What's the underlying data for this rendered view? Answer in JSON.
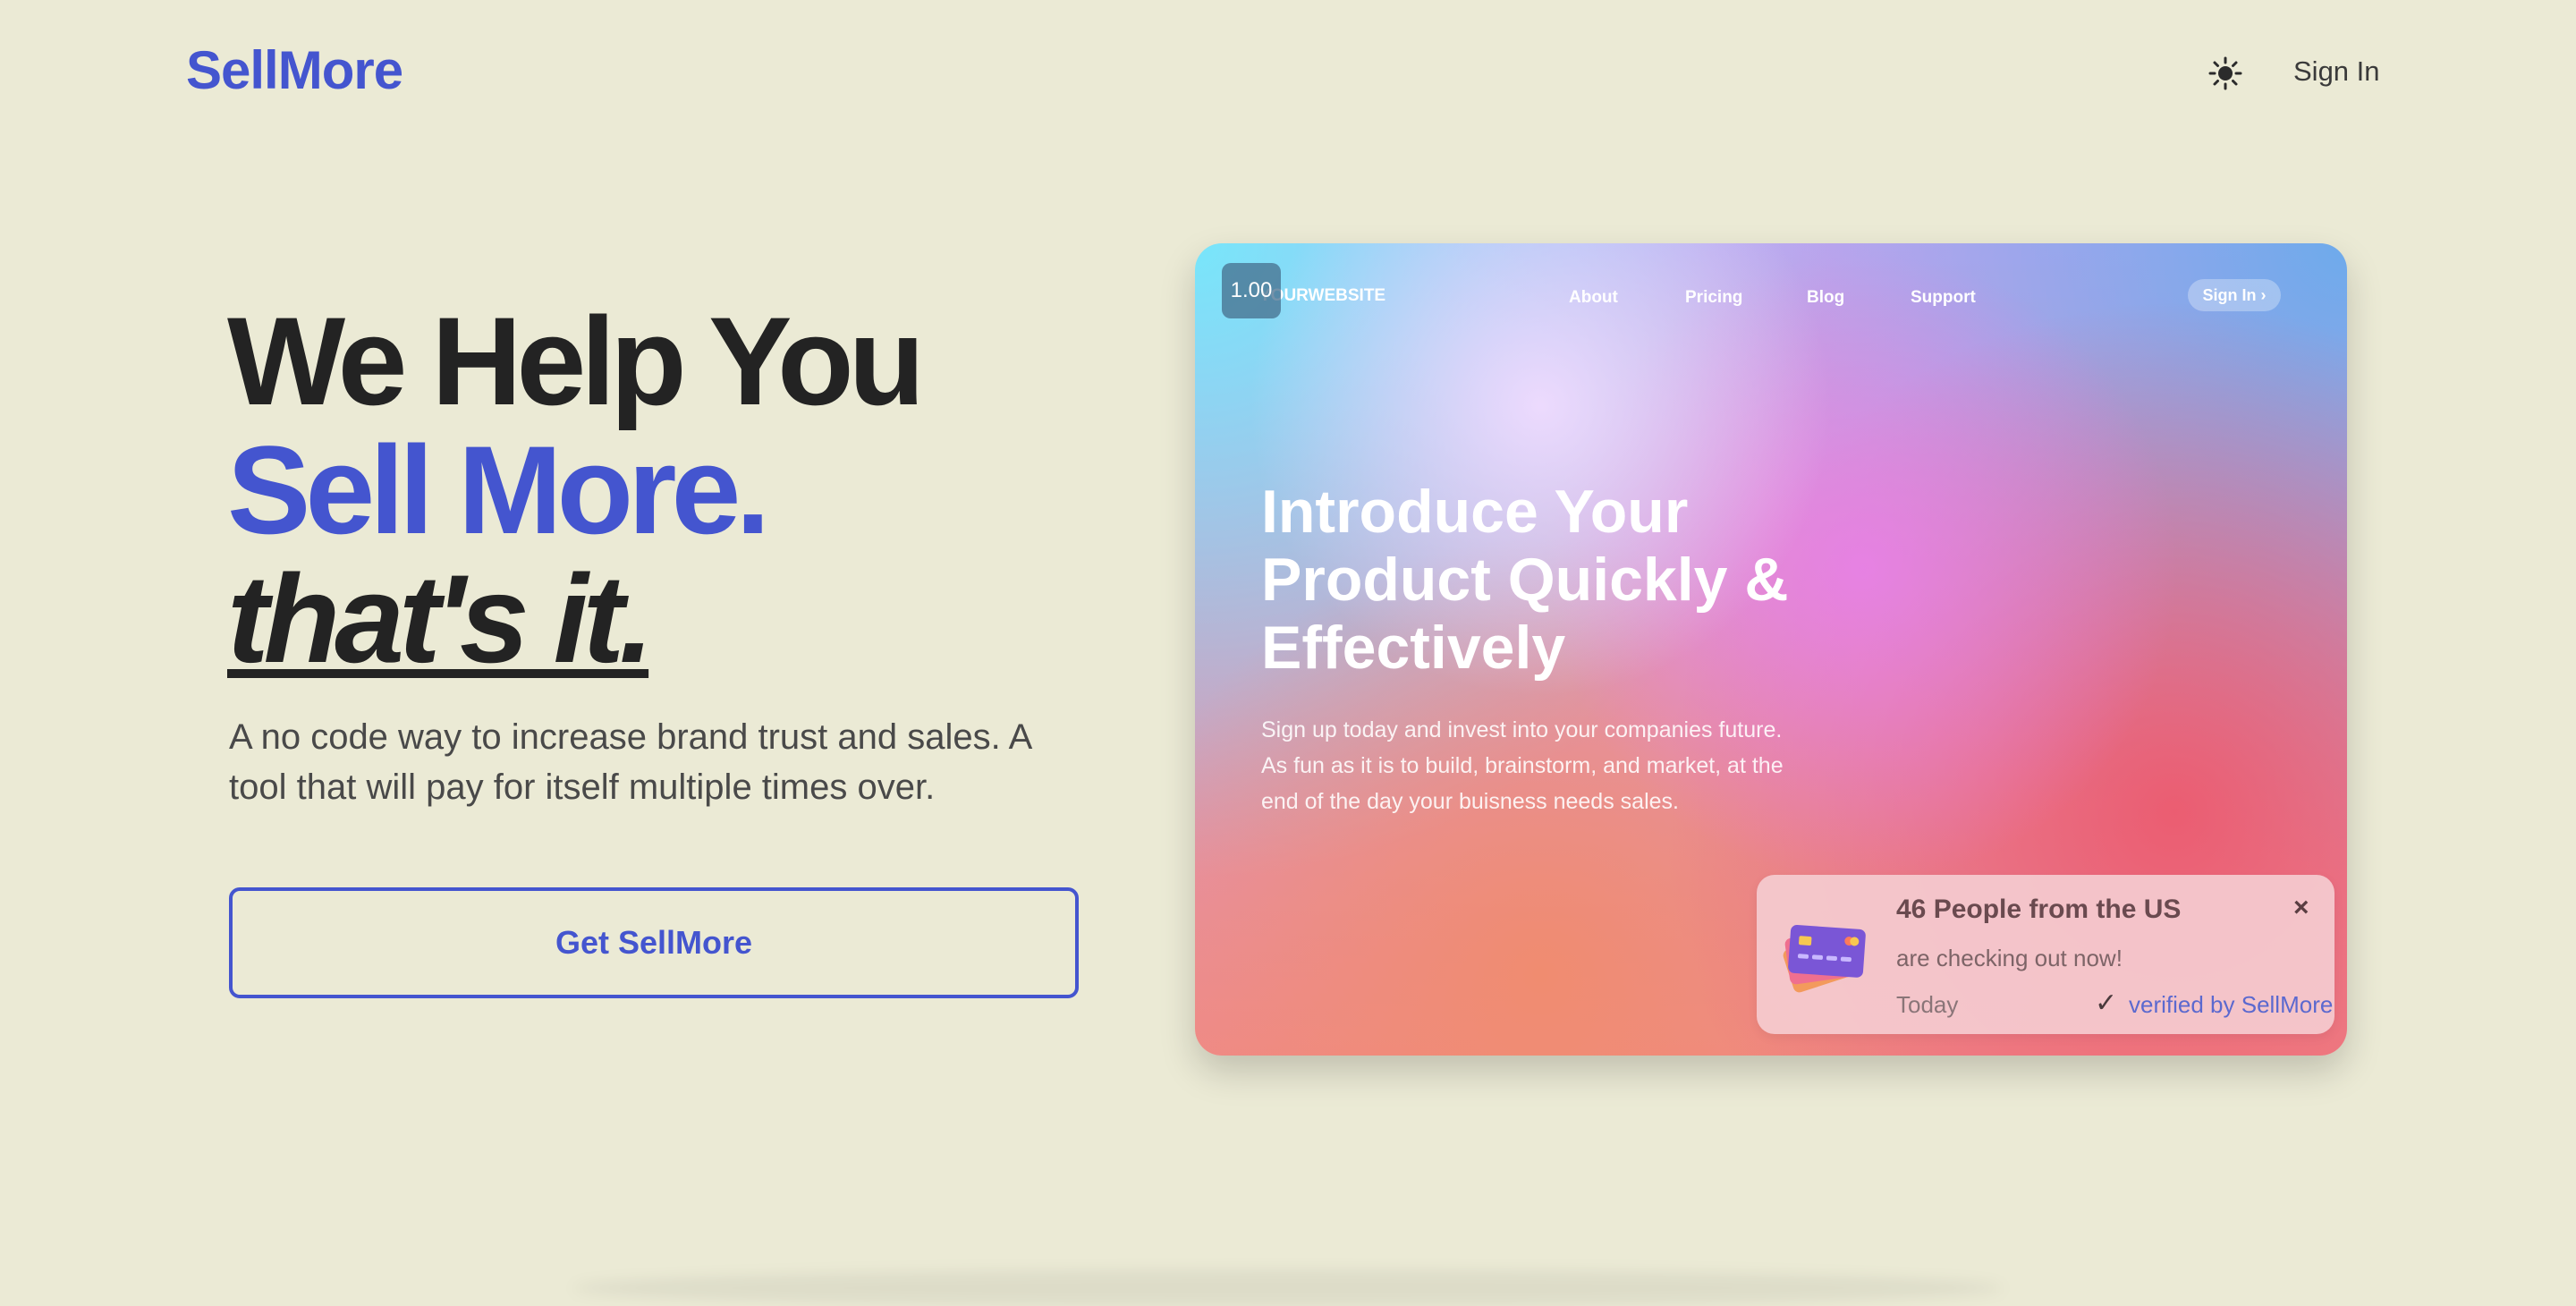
{
  "header": {
    "logo": "SellMore",
    "theme_icon": "sun-icon",
    "signin_label": "Sign In"
  },
  "hero": {
    "line1": "We Help You",
    "line2": "Sell More.",
    "line3": "that's it.",
    "subtext": "A no code way to increase brand trust and sales. A tool that will pay for itself multiple times over.",
    "cta_label": "Get SellMore"
  },
  "preview": {
    "zoom": "1.00",
    "brand": "YOURWEBSITE",
    "nav": [
      "About",
      "Pricing",
      "Blog",
      "Support"
    ],
    "signin_label": "Sign In ›",
    "title": "Introduce Your Product Quickly & Effectively",
    "body": "Sign up today and invest into your companies future. As fun as it is to build, brainstorm, and market, at the end of the day your buisness needs sales."
  },
  "notification": {
    "title": "46 People from the US",
    "subtitle": "are checking out now!",
    "time": "Today",
    "check_icon": "checkmark-icon",
    "verified": "verified by SellMore",
    "close": "×",
    "card_icon": "credit-card-icon"
  },
  "colors": {
    "background": "#ebead5",
    "accent": "#4455cf",
    "text_dark": "#232323"
  }
}
